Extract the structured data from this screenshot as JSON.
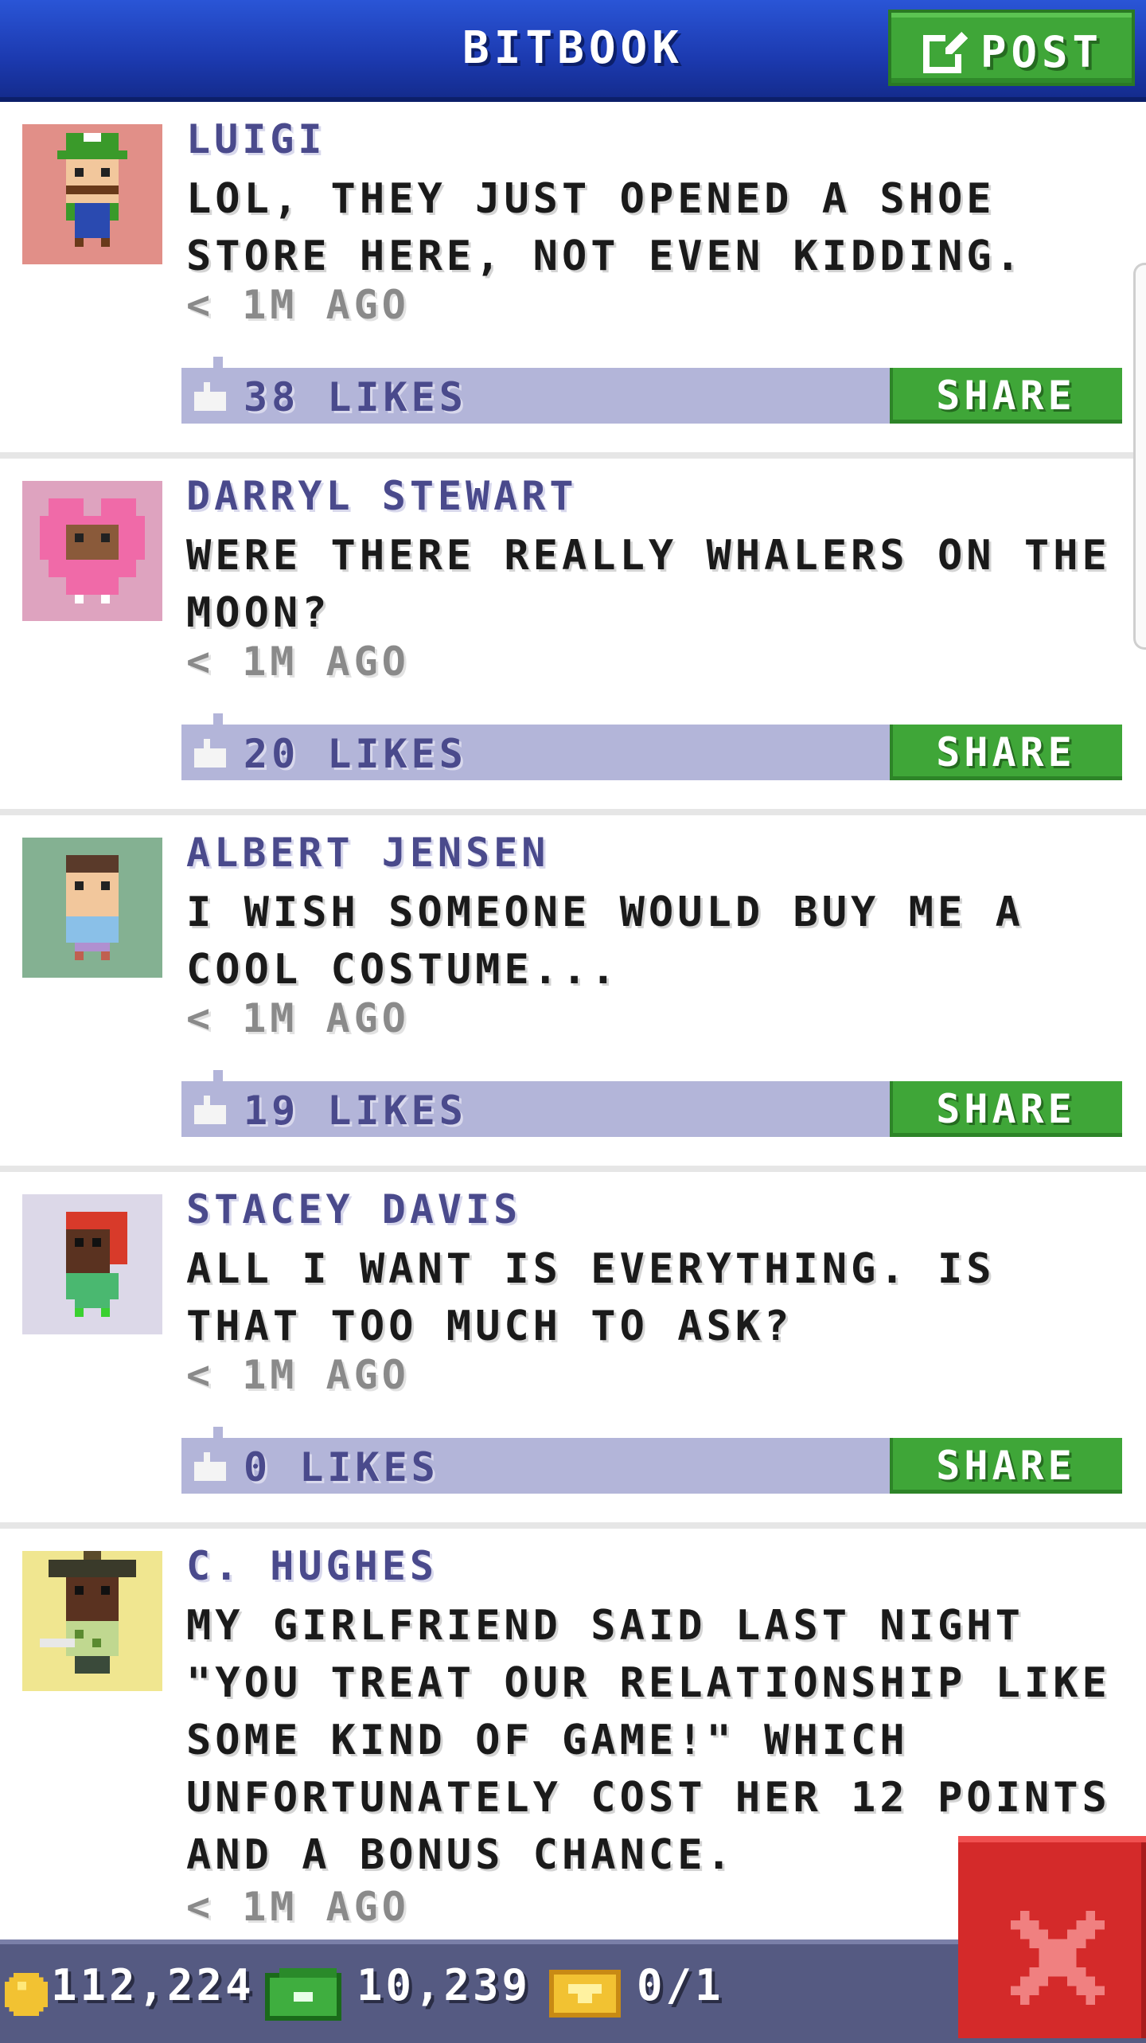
{
  "header": {
    "title": "BITBOOK",
    "post_label": "POST"
  },
  "feed": {
    "posts": [
      {
        "author": "LUIGI",
        "message": "LOL, THEY JUST OPENED A SHOE STORE HERE, NOT EVEN KIDDING.",
        "time": "< 1M AGO",
        "likes": "38 LIKES",
        "share_label": "SHARE",
        "avatar_bg": "#e18f88"
      },
      {
        "author": "DARRYL STEWART",
        "message": "WERE THERE REALLY WHALERS ON THE MOON?",
        "time": "< 1M AGO",
        "likes": "20 LIKES",
        "share_label": "SHARE",
        "avatar_bg": "#dea3bf"
      },
      {
        "author": "ALBERT JENSEN",
        "message": "I WISH SOMEONE WOULD BUY ME A COOL COSTUME...",
        "time": "< 1M AGO",
        "likes": "19 LIKES",
        "share_label": "SHARE",
        "avatar_bg": "#84b192"
      },
      {
        "author": "STACEY DAVIS",
        "message": "ALL I WANT IS EVERYTHING. IS THAT TOO MUCH TO ASK?",
        "time": "< 1M AGO",
        "likes": "0 LIKES",
        "share_label": "SHARE",
        "avatar_bg": "#dcd8e8"
      },
      {
        "author": "C. HUGHES",
        "message": "MY GIRLFRIEND SAID LAST NIGHT \"YOU TREAT OUR RELATIONSHIP LIKE SOME KIND OF GAME!\" WHICH UNFORTUNATELY COST HER 12 POINTS AND A BONUS CHANCE.",
        "time": "< 1M AGO",
        "avatar_bg": "#f0e690"
      }
    ]
  },
  "status_bar": {
    "coins": "112,224",
    "bux": "10,239",
    "tickets": "0/1"
  },
  "colors": {
    "header_blue": "#1c3ab0",
    "share_green": "#3fa638",
    "likes_bar": "#b3b5d9",
    "close_red": "#d42a2a"
  },
  "icons": {
    "post": "compose-icon",
    "like": "thumbs-up-icon",
    "coin": "coin-icon",
    "bux": "cash-icon",
    "ticket": "ticket-icon",
    "close": "close-icon"
  }
}
